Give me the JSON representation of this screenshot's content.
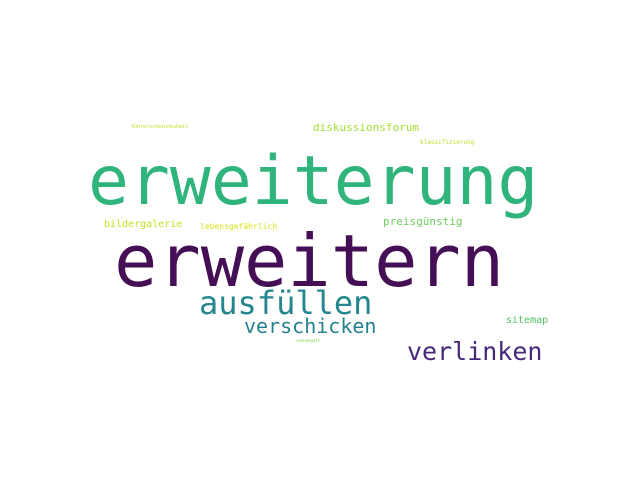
{
  "words": [
    {
      "id": "erweiterung",
      "text": "erweiterung",
      "color": "#2fb47c"
    },
    {
      "id": "erweitern",
      "text": "erweitern",
      "color": "#440f55"
    },
    {
      "id": "ausfuellen",
      "text": "ausfüllen",
      "color": "#24878e"
    },
    {
      "id": "verschicken",
      "text": "verschicken",
      "color": "#26818e"
    },
    {
      "id": "verlinken",
      "text": "verlinken",
      "color": "#482979"
    },
    {
      "id": "diskussionsforum",
      "text": "diskussionsforum",
      "color": "#a8db34"
    },
    {
      "id": "preisguenstig",
      "text": "preisgünstig",
      "color": "#6ccd5a"
    },
    {
      "id": "bildergalerie",
      "text": "bildergalerie",
      "color": "#c7e020"
    },
    {
      "id": "lebensgefaehrlich",
      "text": "lebensgefährlich",
      "color": "#d4e21a"
    },
    {
      "id": "sitemap",
      "text": "sitemap",
      "color": "#50c46a"
    },
    {
      "id": "fuehrerscheinneuheit",
      "text": "führerscheinneuheit",
      "color": "#c0df25"
    },
    {
      "id": "klassifizierung",
      "text": "klassifizierung",
      "color": "#bddf26"
    },
    {
      "id": "sonnengast",
      "text": "sonnengast",
      "color": "#7ad151"
    }
  ]
}
